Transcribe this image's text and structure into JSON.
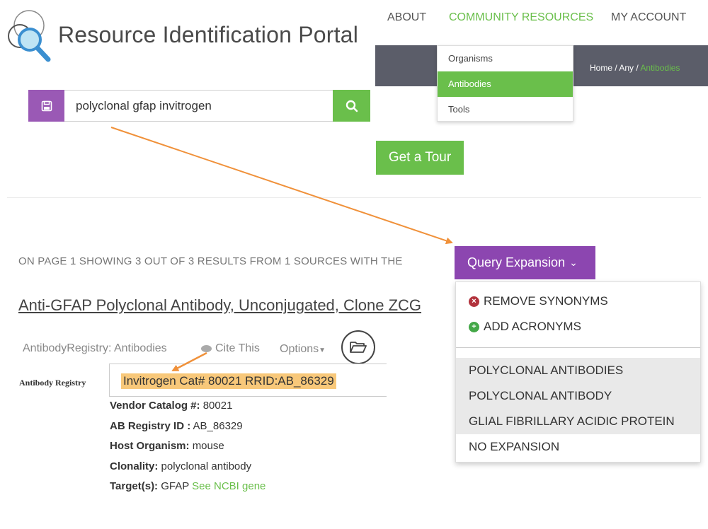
{
  "header": {
    "site_title": "Resource Identification Portal",
    "logo_icon": "magnifier-circles-icon"
  },
  "nav": {
    "items": [
      {
        "label": "ABOUT"
      },
      {
        "label": "COMMUNITY RESOURCES",
        "active": true
      },
      {
        "label": "MY ACCOUNT"
      }
    ],
    "dropdown": [
      {
        "label": "Organisms"
      },
      {
        "label": "Antibodies",
        "selected": true
      },
      {
        "label": "Tools"
      }
    ]
  },
  "breadcrumb": [
    {
      "label": "Home /"
    },
    {
      "label": "Any /"
    },
    {
      "label": "Antibodies",
      "current": true
    }
  ],
  "search": {
    "value": "polyclonal gfap invitrogen",
    "save_icon": "save-icon",
    "search_icon": "search-icon"
  },
  "tour": {
    "label": "Get a Tour"
  },
  "results": {
    "summary": "ON PAGE 1 SHOWING 3 OUT OF 3 RESULTS FROM 1 SOURCES WITH THE",
    "query_expansion": {
      "label": "Query Expansion",
      "actions": [
        {
          "label": "REMOVE SYNONYMS",
          "icon": "remove-circle-icon",
          "color": "#b2333d"
        },
        {
          "label": "ADD ACRONYMS",
          "icon": "add-circle-icon",
          "color": "#44a848"
        }
      ],
      "terms": [
        {
          "label": "POLYCLONAL ANTIBODIES"
        },
        {
          "label": "POLYCLONAL ANTIBODY"
        },
        {
          "label": "GLIAL FIBRILLARY ACIDIC PROTEIN"
        }
      ],
      "none_option": "NO EXPANSION"
    }
  },
  "result": {
    "title": "Anti-GFAP Polyclonal Antibody, Unconjugated, Clone ZCG",
    "source": "AntibodyRegistry: Antibodies",
    "cite_label": "Cite This",
    "options_label": "Options",
    "registry_label": "Antibody Registry",
    "registry_id": "Invitrogen Cat# 80021 RRID:AB_86329",
    "fields": {
      "vendor_catalog_label": "Vendor Catalog #:",
      "vendor_catalog_value": "80021",
      "ab_registry_label": "AB Registry ID :",
      "ab_registry_value": "AB_86329",
      "host_label": "Host Organism:",
      "host_value": "mouse",
      "clonality_label": "Clonality:",
      "clonality_value": "polyclonal antibody",
      "targets_label": "Target(s):",
      "targets_value": "GFAP",
      "ncbi_link": "See NCBI gene"
    }
  },
  "colors": {
    "accent_green": "#6abf4b",
    "accent_purple": "#8c46b0",
    "save_purple": "#9a59b5",
    "nav_dark": "#5b5d69",
    "highlight": "#f8c87a",
    "arrow": "#f0913a"
  }
}
